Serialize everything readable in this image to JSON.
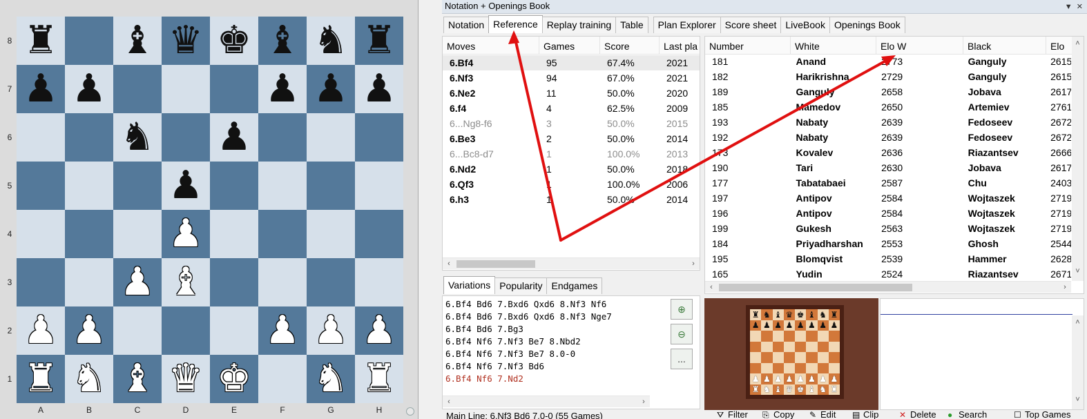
{
  "board": {
    "ranks": [
      "8",
      "7",
      "6",
      "5",
      "4",
      "3",
      "2",
      "1"
    ],
    "files": [
      "A",
      "B",
      "C",
      "D",
      "E",
      "F",
      "G",
      "H"
    ],
    "position": [
      [
        "br",
        "",
        "bb",
        "bq",
        "bk",
        "bb",
        "bn",
        "br"
      ],
      [
        "bp",
        "bp",
        "",
        "",
        "",
        "bp",
        "bp",
        "bp"
      ],
      [
        "",
        "",
        "bn",
        "",
        "bp",
        "",
        "",
        ""
      ],
      [
        "",
        "",
        "",
        "bp",
        "",
        "",
        "",
        ""
      ],
      [
        "",
        "",
        "",
        "wp",
        "",
        "",
        "",
        ""
      ],
      [
        "",
        "",
        "wp",
        "wb",
        "",
        "",
        "",
        ""
      ],
      [
        "wp",
        "wp",
        "",
        "",
        "",
        "wp",
        "wp",
        "wp"
      ],
      [
        "wr",
        "wn",
        "wb",
        "wq",
        "wk",
        "",
        "wn",
        "wr"
      ]
    ]
  },
  "window": {
    "title": "Notation + Openings Book",
    "tabs": [
      "Notation",
      "Reference",
      "Replay training",
      "Table",
      "Plan Explorer",
      "Score sheet",
      "LiveBook",
      "Openings Book"
    ],
    "active_tab": "Reference"
  },
  "moves_table": {
    "headers": [
      "Moves",
      "Games",
      "Score",
      "Last pla"
    ],
    "rows": [
      {
        "move": "6.Bf4",
        "games": "95",
        "score": "67.4%",
        "last": "2021",
        "grey": false,
        "selected": true
      },
      {
        "move": "6.Nf3",
        "games": "94",
        "score": "67.0%",
        "last": "2021",
        "grey": false,
        "selected": false
      },
      {
        "move": "6.Ne2",
        "games": "11",
        "score": "50.0%",
        "last": "2020",
        "grey": false,
        "selected": false
      },
      {
        "move": "6.f4",
        "games": "4",
        "score": "62.5%",
        "last": "2009",
        "grey": false,
        "selected": false
      },
      {
        "move": "6...Ng8-f6",
        "games": "3",
        "score": "50.0%",
        "last": "2015",
        "grey": true,
        "selected": false
      },
      {
        "move": "6.Be3",
        "games": "2",
        "score": "50.0%",
        "last": "2014",
        "grey": false,
        "selected": false
      },
      {
        "move": "6...Bc8-d7",
        "games": "1",
        "score": "100.0%",
        "last": "2013",
        "grey": true,
        "selected": false
      },
      {
        "move": "6.Nd2",
        "games": "1",
        "score": "50.0%",
        "last": "2018",
        "grey": false,
        "selected": false
      },
      {
        "move": "6.Qf3",
        "games": "1",
        "score": "100.0%",
        "last": "2006",
        "grey": false,
        "selected": false
      },
      {
        "move": "6.h3",
        "games": "1",
        "score": "50.0%",
        "last": "2014",
        "grey": false,
        "selected": false
      }
    ]
  },
  "variations": {
    "tabs": [
      "Variations",
      "Popularity",
      "Endgames"
    ],
    "lines": [
      {
        "text": "6.Bf4 Bd6 7.Bxd6 Qxd6 8.Nf3 Nf6",
        "red": false
      },
      {
        "text": "6.Bf4 Bd6 7.Bxd6 Qxd6 8.Nf3 Nge7",
        "red": false
      },
      {
        "text": "6.Bf4 Bd6 7.Bg3",
        "red": false
      },
      {
        "text": "6.Bf4 Nf6 7.Nf3 Be7 8.Nbd2",
        "red": false
      },
      {
        "text": "6.Bf4 Nf6 7.Nf3 Be7 8.0-0",
        "red": false
      },
      {
        "text": "6.Bf4 Nf6 7.Nf3 Bd6",
        "red": false
      },
      {
        "text": "6.Bf4 Nf6 7.Nd2",
        "red": true
      }
    ],
    "more_label": "...",
    "status": "Main Line: 6.Nf3 Bd6 7.0-0   (55 Games)"
  },
  "games_table": {
    "headers": [
      "Number",
      "White",
      "Elo W",
      "Black",
      "Elo"
    ],
    "rows": [
      [
        "181",
        "Anand",
        "2773",
        "Ganguly",
        "2615"
      ],
      [
        "182",
        "Harikrishna",
        "2729",
        "Ganguly",
        "2615"
      ],
      [
        "189",
        "Ganguly",
        "2658",
        "Jobava",
        "2617"
      ],
      [
        "185",
        "Mamedov",
        "2650",
        "Artemiev",
        "2761"
      ],
      [
        "193",
        "Nabaty",
        "2639",
        "Fedoseev",
        "2672"
      ],
      [
        "192",
        "Nabaty",
        "2639",
        "Fedoseev",
        "2672"
      ],
      [
        "173",
        "Kovalev",
        "2636",
        "Riazantsev",
        "2666"
      ],
      [
        "190",
        "Tari",
        "2630",
        "Jobava",
        "2617"
      ],
      [
        "177",
        "Tabatabaei",
        "2587",
        "Chu",
        "2403"
      ],
      [
        "197",
        "Antipov",
        "2584",
        "Wojtaszek",
        "2719"
      ],
      [
        "196",
        "Antipov",
        "2584",
        "Wojtaszek",
        "2719"
      ],
      [
        "199",
        "Gukesh",
        "2563",
        "Wojtaszek",
        "2719"
      ],
      [
        "184",
        "Priyadharshan",
        "2553",
        "Ghosh",
        "2544"
      ],
      [
        "195",
        "Blomqvist",
        "2539",
        "Hammer",
        "2628"
      ],
      [
        "165",
        "Yudin",
        "2524",
        "Riazantsev",
        "2671"
      ]
    ]
  },
  "toolbar": {
    "filter": "Filter",
    "copy": "Copy",
    "edit": "Edit",
    "clip": "Clip",
    "delete": "Delete",
    "search": "Search",
    "top_games": "Top Games"
  },
  "colors": {
    "board_light": "#d6e0ea",
    "board_dark": "#54799a",
    "annotation_arrow": "#e01010",
    "mini_light": "#f2d8b5",
    "mini_dark": "#d2783a"
  }
}
